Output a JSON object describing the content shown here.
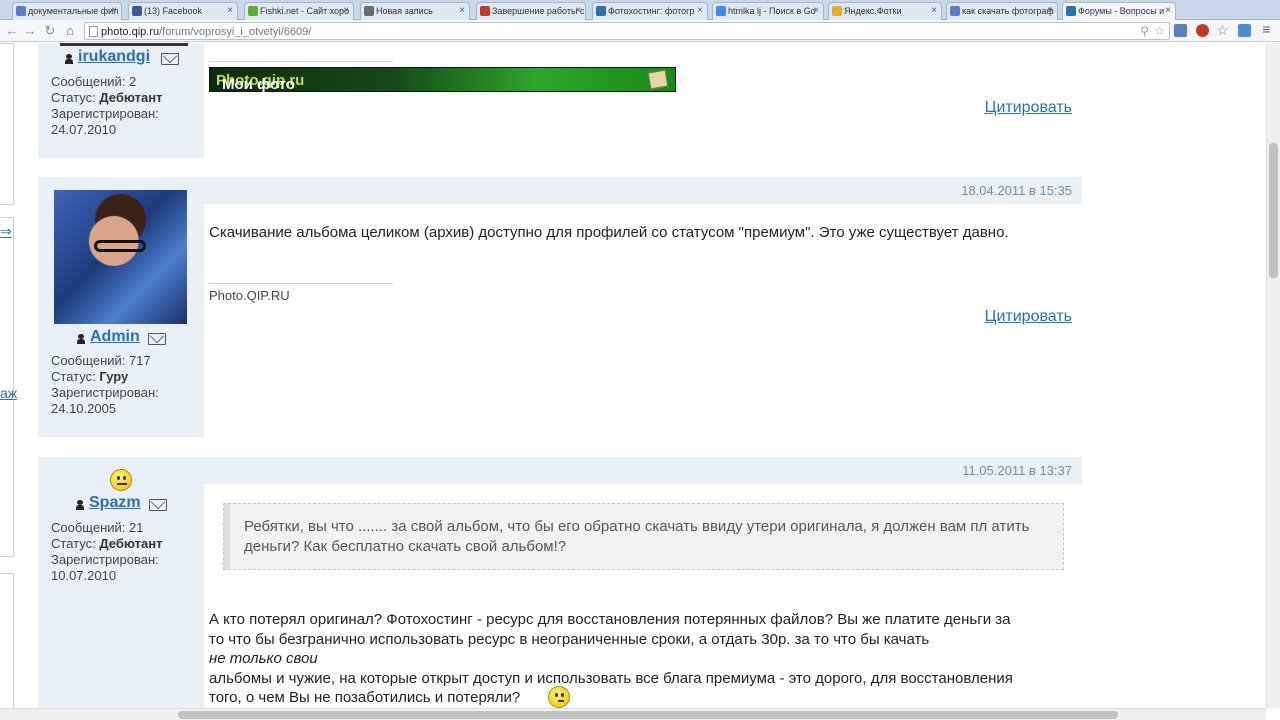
{
  "tabs": [
    {
      "title": "документальные фил",
      "color": "#5a7fc4"
    },
    {
      "title": "(13) Facebook",
      "color": "#3b5998"
    },
    {
      "title": "Fishki.net - Сайт хоро",
      "color": "#5cb030"
    },
    {
      "title": "Новая запись",
      "color": "#6b6b6b"
    },
    {
      "title": "Завершение работы с",
      "color": "#c0392b"
    },
    {
      "title": "Фотохостинг: фотогр",
      "color": "#2a6fb0"
    },
    {
      "title": "htmlka lj - Поиск в Go",
      "color": "#4285f4"
    },
    {
      "title": "Яндекс.Фотки",
      "color": "#e0b020"
    },
    {
      "title": "как скачать фотограф",
      "color": "#5a7fc4"
    },
    {
      "title": "Форумы - Вопросы и",
      "color": "#2a6fb0",
      "active": true
    }
  ],
  "url": {
    "domain": "photo.qip.ru",
    "path": "/forum/voprosyi_i_otvetyi/6609/"
  },
  "left_link": "аж",
  "posts": [
    {
      "username": "irukandgi",
      "messages": "Сообщений: 2",
      "status_label": "Статус:",
      "status": "Дебютант",
      "registered_label": "Зарегистрирован:",
      "registered": "24.07.2010",
      "banner_text_1": "Мои фото на ",
      "banner_text_2": "Photo.qip.ru",
      "quote_label": "Цитировать"
    },
    {
      "username": "Admin",
      "date": "18.04.2011 в 15:35",
      "messages": "Сообщений: 717",
      "status_label": "Статус:",
      "status": "Гуру",
      "registered_label": "Зарегистрирован:",
      "registered": "24.10.2005",
      "text": "Скачивание альбома целиком (архив) доступно для профилей со статусом \"премиум\". Это уже существует давно.",
      "signature": "Photo.QIP.RU",
      "quote_label": "Цитировать"
    },
    {
      "username": "Spazm",
      "date": "11.05.2011 в 13:37",
      "messages": "Сообщений: 21",
      "status_label": "Статус:",
      "status": "Дебютант",
      "registered_label": "Зарегистрирован:",
      "registered": "10.07.2010",
      "quote": "Ребятки, вы что ....... за свой альбом, что бы его обратно скачать ввиду утери оригинала, я должен вам пл атить деньги? Как бесплатно скачать свой альбом!?",
      "line1": "А кто потерял оригинал? Фотохостинг - ресурс для восстановления потерянных файлов? Вы же платите деньги за",
      "line2": "то что бы безгранично использовать ресурс в неограниченные сроки, а отдать 30р. за то что бы качать",
      "line3": "не только свои",
      "line4": "альбомы и чужие, на которые открыт доступ и использовать все блага премиума - это дорого, для восстановления",
      "line5": "того, о чем Вы не позаботились и потеряли?"
    }
  ]
}
